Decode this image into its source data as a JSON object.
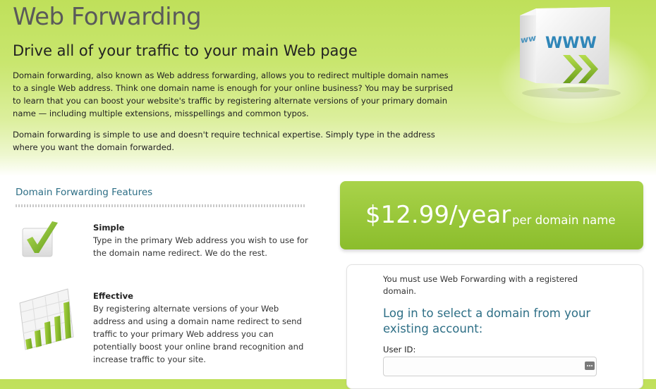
{
  "page": {
    "title": "Web Forwarding",
    "subtitle": "Drive all of your traffic to your main Web page",
    "intro_paragraphs": [
      "Domain forwarding, also known as Web address forwarding, allows you to redirect multiple domain names to a single Web address. Think one domain name is enough for your online business? You may be surprised to learn that you can boost your website's traffic by registering alternate versions of your primary domain name — including multiple extensions, misspellings and common typos.",
      "Domain forwarding is simple to use and doesn't require technical expertise. Simply type in the address where you want the domain forwarded."
    ],
    "hero_cube_text": "WWW"
  },
  "features": {
    "heading": "Domain Forwarding Features",
    "items": [
      {
        "icon": "checkmark-icon",
        "title": "Simple",
        "description": "Type in the primary Web address you wish to use for the domain name redirect. We do the rest."
      },
      {
        "icon": "bar-chart-icon",
        "title": "Effective",
        "description": "By registering alternate versions of your Web address and using a domain name redirect to send traffic to your primary Web address you can potentially boost your online brand recognition and increase traffic to your site."
      }
    ]
  },
  "pricing": {
    "amount": "$12.99/year",
    "unit": "per domain name"
  },
  "login": {
    "note": "You must use Web Forwarding with a registered domain.",
    "heading": "Log in to select a domain from your existing account:",
    "userid_label": "User ID:",
    "userid_value": ""
  },
  "colors": {
    "brand_green": "#8bbd2c",
    "heading_teal": "#2e6f86"
  }
}
